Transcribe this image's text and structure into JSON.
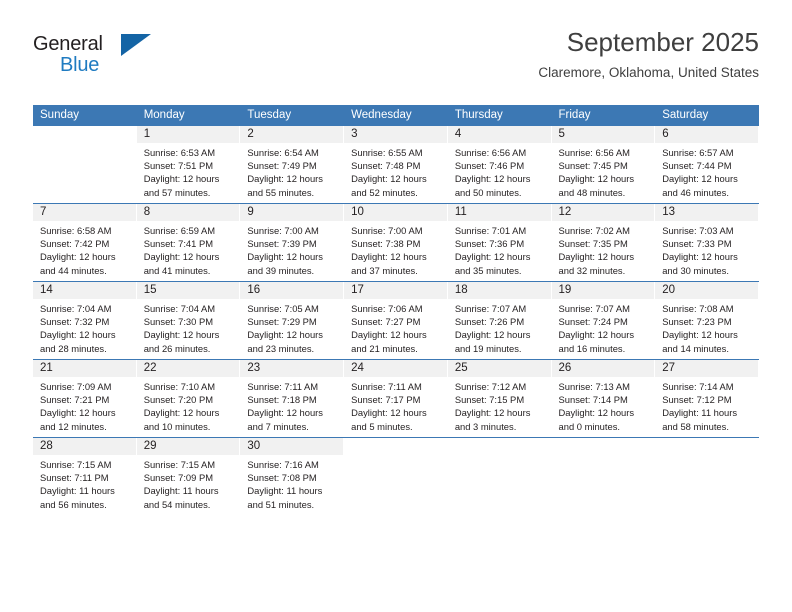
{
  "brand": {
    "name_part1": "General",
    "name_part2": "Blue",
    "accent_color": "#1464a5",
    "logo_icon": "triangle-logo-icon"
  },
  "header": {
    "title": "September 2025",
    "location": "Claremore, Oklahoma, United States"
  },
  "theme": {
    "header_blue": "#3c78b4",
    "daynum_band": "#f1f1f1",
    "text": "#231f20"
  },
  "weekday_headers": [
    "Sunday",
    "Monday",
    "Tuesday",
    "Wednesday",
    "Thursday",
    "Friday",
    "Saturday"
  ],
  "weeks": [
    [
      {
        "day": "",
        "sunrise": "",
        "sunset": "",
        "daylight_1": "",
        "daylight_2": ""
      },
      {
        "day": "1",
        "sunrise": "Sunrise: 6:53 AM",
        "sunset": "Sunset: 7:51 PM",
        "daylight_1": "Daylight: 12 hours",
        "daylight_2": "and 57 minutes."
      },
      {
        "day": "2",
        "sunrise": "Sunrise: 6:54 AM",
        "sunset": "Sunset: 7:49 PM",
        "daylight_1": "Daylight: 12 hours",
        "daylight_2": "and 55 minutes."
      },
      {
        "day": "3",
        "sunrise": "Sunrise: 6:55 AM",
        "sunset": "Sunset: 7:48 PM",
        "daylight_1": "Daylight: 12 hours",
        "daylight_2": "and 52 minutes."
      },
      {
        "day": "4",
        "sunrise": "Sunrise: 6:56 AM",
        "sunset": "Sunset: 7:46 PM",
        "daylight_1": "Daylight: 12 hours",
        "daylight_2": "and 50 minutes."
      },
      {
        "day": "5",
        "sunrise": "Sunrise: 6:56 AM",
        "sunset": "Sunset: 7:45 PM",
        "daylight_1": "Daylight: 12 hours",
        "daylight_2": "and 48 minutes."
      },
      {
        "day": "6",
        "sunrise": "Sunrise: 6:57 AM",
        "sunset": "Sunset: 7:44 PM",
        "daylight_1": "Daylight: 12 hours",
        "daylight_2": "and 46 minutes."
      }
    ],
    [
      {
        "day": "7",
        "sunrise": "Sunrise: 6:58 AM",
        "sunset": "Sunset: 7:42 PM",
        "daylight_1": "Daylight: 12 hours",
        "daylight_2": "and 44 minutes."
      },
      {
        "day": "8",
        "sunrise": "Sunrise: 6:59 AM",
        "sunset": "Sunset: 7:41 PM",
        "daylight_1": "Daylight: 12 hours",
        "daylight_2": "and 41 minutes."
      },
      {
        "day": "9",
        "sunrise": "Sunrise: 7:00 AM",
        "sunset": "Sunset: 7:39 PM",
        "daylight_1": "Daylight: 12 hours",
        "daylight_2": "and 39 minutes."
      },
      {
        "day": "10",
        "sunrise": "Sunrise: 7:00 AM",
        "sunset": "Sunset: 7:38 PM",
        "daylight_1": "Daylight: 12 hours",
        "daylight_2": "and 37 minutes."
      },
      {
        "day": "11",
        "sunrise": "Sunrise: 7:01 AM",
        "sunset": "Sunset: 7:36 PM",
        "daylight_1": "Daylight: 12 hours",
        "daylight_2": "and 35 minutes."
      },
      {
        "day": "12",
        "sunrise": "Sunrise: 7:02 AM",
        "sunset": "Sunset: 7:35 PM",
        "daylight_1": "Daylight: 12 hours",
        "daylight_2": "and 32 minutes."
      },
      {
        "day": "13",
        "sunrise": "Sunrise: 7:03 AM",
        "sunset": "Sunset: 7:33 PM",
        "daylight_1": "Daylight: 12 hours",
        "daylight_2": "and 30 minutes."
      }
    ],
    [
      {
        "day": "14",
        "sunrise": "Sunrise: 7:04 AM",
        "sunset": "Sunset: 7:32 PM",
        "daylight_1": "Daylight: 12 hours",
        "daylight_2": "and 28 minutes."
      },
      {
        "day": "15",
        "sunrise": "Sunrise: 7:04 AM",
        "sunset": "Sunset: 7:30 PM",
        "daylight_1": "Daylight: 12 hours",
        "daylight_2": "and 26 minutes."
      },
      {
        "day": "16",
        "sunrise": "Sunrise: 7:05 AM",
        "sunset": "Sunset: 7:29 PM",
        "daylight_1": "Daylight: 12 hours",
        "daylight_2": "and 23 minutes."
      },
      {
        "day": "17",
        "sunrise": "Sunrise: 7:06 AM",
        "sunset": "Sunset: 7:27 PM",
        "daylight_1": "Daylight: 12 hours",
        "daylight_2": "and 21 minutes."
      },
      {
        "day": "18",
        "sunrise": "Sunrise: 7:07 AM",
        "sunset": "Sunset: 7:26 PM",
        "daylight_1": "Daylight: 12 hours",
        "daylight_2": "and 19 minutes."
      },
      {
        "day": "19",
        "sunrise": "Sunrise: 7:07 AM",
        "sunset": "Sunset: 7:24 PM",
        "daylight_1": "Daylight: 12 hours",
        "daylight_2": "and 16 minutes."
      },
      {
        "day": "20",
        "sunrise": "Sunrise: 7:08 AM",
        "sunset": "Sunset: 7:23 PM",
        "daylight_1": "Daylight: 12 hours",
        "daylight_2": "and 14 minutes."
      }
    ],
    [
      {
        "day": "21",
        "sunrise": "Sunrise: 7:09 AM",
        "sunset": "Sunset: 7:21 PM",
        "daylight_1": "Daylight: 12 hours",
        "daylight_2": "and 12 minutes."
      },
      {
        "day": "22",
        "sunrise": "Sunrise: 7:10 AM",
        "sunset": "Sunset: 7:20 PM",
        "daylight_1": "Daylight: 12 hours",
        "daylight_2": "and 10 minutes."
      },
      {
        "day": "23",
        "sunrise": "Sunrise: 7:11 AM",
        "sunset": "Sunset: 7:18 PM",
        "daylight_1": "Daylight: 12 hours",
        "daylight_2": "and 7 minutes."
      },
      {
        "day": "24",
        "sunrise": "Sunrise: 7:11 AM",
        "sunset": "Sunset: 7:17 PM",
        "daylight_1": "Daylight: 12 hours",
        "daylight_2": "and 5 minutes."
      },
      {
        "day": "25",
        "sunrise": "Sunrise: 7:12 AM",
        "sunset": "Sunset: 7:15 PM",
        "daylight_1": "Daylight: 12 hours",
        "daylight_2": "and 3 minutes."
      },
      {
        "day": "26",
        "sunrise": "Sunrise: 7:13 AM",
        "sunset": "Sunset: 7:14 PM",
        "daylight_1": "Daylight: 12 hours",
        "daylight_2": "and 0 minutes."
      },
      {
        "day": "27",
        "sunrise": "Sunrise: 7:14 AM",
        "sunset": "Sunset: 7:12 PM",
        "daylight_1": "Daylight: 11 hours",
        "daylight_2": "and 58 minutes."
      }
    ],
    [
      {
        "day": "28",
        "sunrise": "Sunrise: 7:15 AM",
        "sunset": "Sunset: 7:11 PM",
        "daylight_1": "Daylight: 11 hours",
        "daylight_2": "and 56 minutes."
      },
      {
        "day": "29",
        "sunrise": "Sunrise: 7:15 AM",
        "sunset": "Sunset: 7:09 PM",
        "daylight_1": "Daylight: 11 hours",
        "daylight_2": "and 54 minutes."
      },
      {
        "day": "30",
        "sunrise": "Sunrise: 7:16 AM",
        "sunset": "Sunset: 7:08 PM",
        "daylight_1": "Daylight: 11 hours",
        "daylight_2": "and 51 minutes."
      },
      {
        "day": "",
        "sunrise": "",
        "sunset": "",
        "daylight_1": "",
        "daylight_2": ""
      },
      {
        "day": "",
        "sunrise": "",
        "sunset": "",
        "daylight_1": "",
        "daylight_2": ""
      },
      {
        "day": "",
        "sunrise": "",
        "sunset": "",
        "daylight_1": "",
        "daylight_2": ""
      },
      {
        "day": "",
        "sunrise": "",
        "sunset": "",
        "daylight_1": "",
        "daylight_2": ""
      }
    ]
  ]
}
